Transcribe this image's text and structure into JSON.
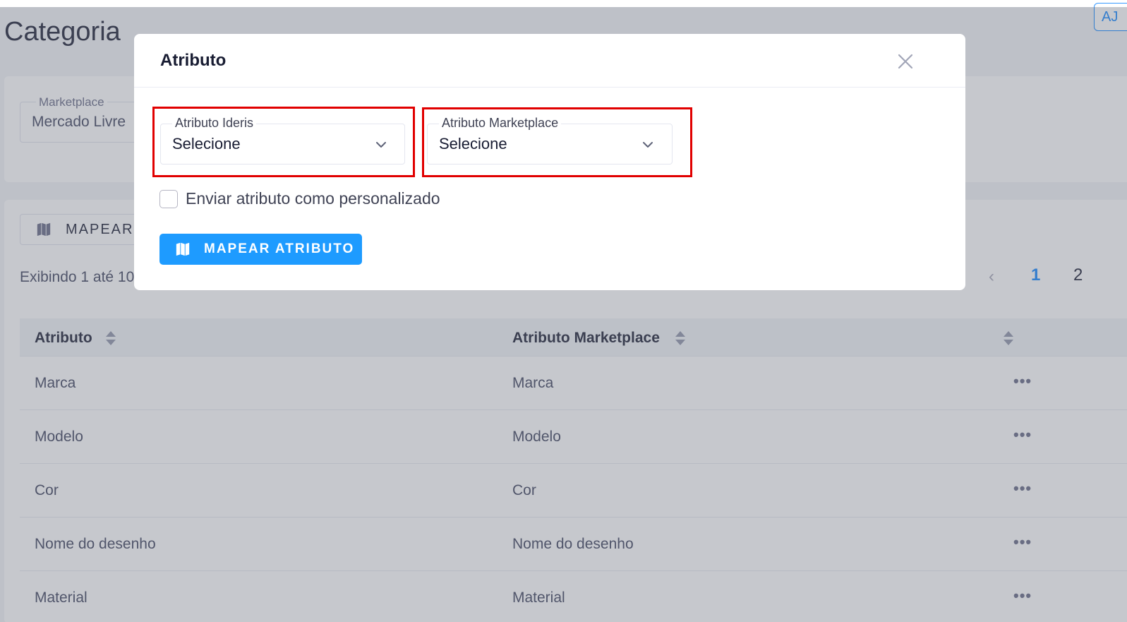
{
  "page": {
    "title": "Categoria",
    "help_button": "AJ"
  },
  "filters": {
    "marketplace_label": "Marketplace",
    "marketplace_value": "Mercado Livre"
  },
  "list": {
    "map_button_label": "MAPEAR A",
    "showing_text": "Exibindo 1 até 10",
    "pagination": {
      "prev_icon": "chevron-left-icon",
      "pages": [
        "1",
        "2"
      ],
      "current": "1"
    },
    "columns": [
      "Atributo",
      "Atributo Marketplace"
    ],
    "rows": [
      {
        "atributo": "Marca",
        "marketplace": "Marca",
        "actions": "•••"
      },
      {
        "atributo": "Modelo",
        "marketplace": "Modelo",
        "actions": "•••"
      },
      {
        "atributo": "Cor",
        "marketplace": "Cor",
        "actions": "•••"
      },
      {
        "atributo": "Nome do desenho",
        "marketplace": "Nome do desenho",
        "actions": "•••"
      },
      {
        "atributo": "Material",
        "marketplace": "Material",
        "actions": "•••"
      }
    ]
  },
  "modal": {
    "title": "Atributo",
    "close_icon": "close-icon",
    "select_ideris": {
      "label": "Atributo Ideris",
      "value": "Selecione"
    },
    "select_marketplace": {
      "label": "Atributo Marketplace",
      "value": "Selecione"
    },
    "checkbox_label": "Enviar atributo como personalizado",
    "checkbox_checked": false,
    "submit_label": "MAPEAR ATRIBUTO",
    "submit_icon": "map-icon"
  },
  "colors": {
    "accent": "#1e9bff",
    "highlight": "#e10000",
    "page_link": "#3699ff"
  }
}
